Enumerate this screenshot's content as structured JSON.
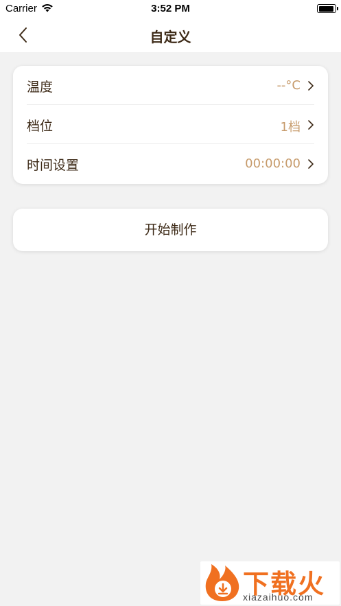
{
  "status_bar": {
    "carrier": "Carrier",
    "time": "3:52 PM"
  },
  "nav": {
    "title": "自定义"
  },
  "settings": {
    "rows": [
      {
        "label": "温度",
        "value": "--°C"
      },
      {
        "label": "档位",
        "value": "1档"
      },
      {
        "label": "时间设置",
        "value": "00:00:00"
      }
    ]
  },
  "actions": {
    "start_label": "开始制作"
  },
  "watermark": {
    "brand": "下载火",
    "url": "xiazaihuo.com"
  },
  "colors": {
    "accent_value": "#c69a6a",
    "text_primary": "#3d2a17",
    "background": "#f2f2f2",
    "watermark": "#f07020"
  }
}
